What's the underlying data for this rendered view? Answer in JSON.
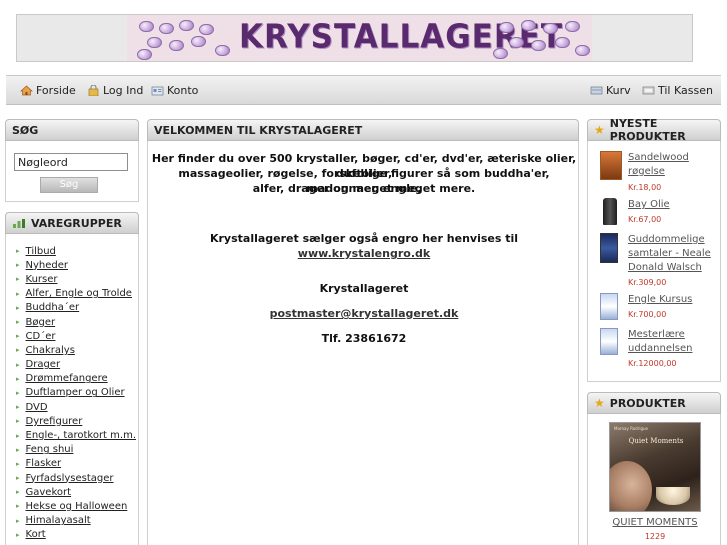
{
  "header": {
    "title": "KRYSTALLAGERET"
  },
  "nav": {
    "home": "Forside",
    "login": "Log Ind",
    "account": "Konto",
    "cart": "Kurv",
    "checkout": "Til Kassen"
  },
  "search": {
    "title": "SØG",
    "placeholder": "Nøgleord",
    "value": "Nøgleord",
    "button": "Søg"
  },
  "categories": {
    "title": "VAREGRUPPER",
    "items": [
      "Tilbud",
      "Nyheder",
      "Kurser",
      "Alfer, Engle og Trolde",
      "Buddha´er",
      "Bøger",
      "CD´er",
      "Chakralys",
      "Drager",
      "Drømmefangere",
      "Duftlamper og Olier",
      "DVD",
      "Dyrefigurer",
      "Engle-, tarotkort m.m.",
      "Feng shui",
      "Flasker",
      "Fyrfadslysestager",
      "Gavekort",
      "Hekse og Halloween",
      "Himalayasalt",
      "Kort"
    ]
  },
  "welcome": {
    "title": "VELKOMMEN TIL KRYSTALAGERET",
    "intro_1": "Her finder du over 500 krystaller, bøger, cd'er, dvd'er, æteriske olier, duftolier,",
    "intro_2": "massageolier, røgelse, forskellige figurer så som buddha'er, madonnaer, engle,",
    "intro_3": "alfer, drager og meget meget mere.",
    "engros_text": "Krystallageret sælger også engro her henvises til ",
    "engros_link": "www.krystalengro.dk",
    "company": "Krystallageret",
    "email": "postmaster@krystallageret.dk",
    "phone": "Tlf. 23861672"
  },
  "newest": {
    "title": "NYESTE PRODUKTER",
    "products": [
      {
        "name": "Sandelwood røgelse",
        "price": "Kr.18,00"
      },
      {
        "name": "Bay Olie",
        "price": "Kr.67,00"
      },
      {
        "name": "Guddommelige samtaler - Neale Donald Walsch",
        "price": "Kr.309,00"
      },
      {
        "name": "Engle Kursus",
        "price": "Kr.700,00"
      },
      {
        "name": "Mesterlære uddannelsen",
        "price": "Kr.12000,00"
      }
    ]
  },
  "products": {
    "title": "PRODUKTER",
    "featured_name": "QUIET MOMENTS",
    "featured_price": "1229",
    "book_title": "Quiet Moments",
    "book_author": "Mornay Rodrigue"
  },
  "colors": {
    "banner_text": "#5a2a6f",
    "price": "#c0392b",
    "bullet": "#6aa84f",
    "star": "#e6a817"
  }
}
